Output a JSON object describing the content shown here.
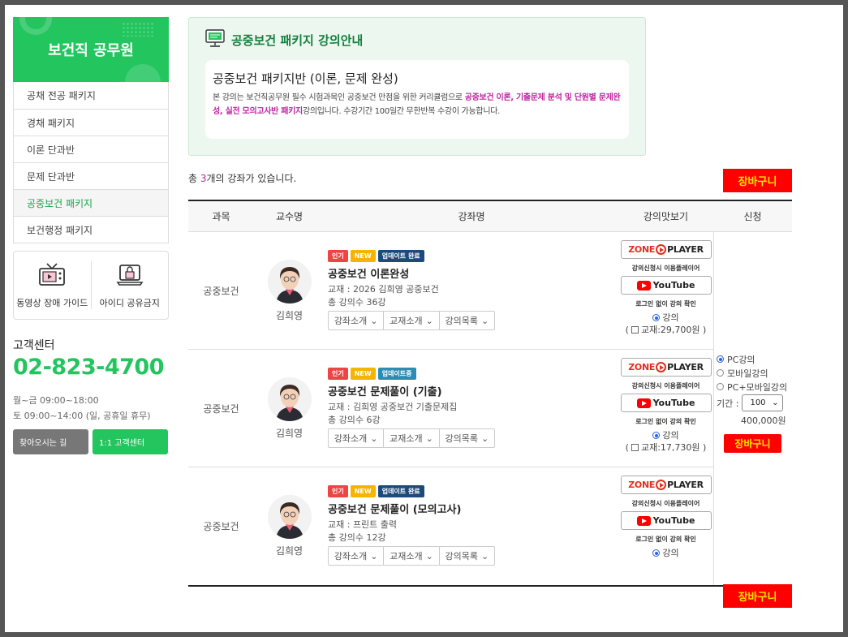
{
  "sidebar": {
    "title": "보건직 공무원",
    "items": [
      {
        "label": "공채 전공 패키지"
      },
      {
        "label": "경채 패키지"
      },
      {
        "label": "이론 단과반"
      },
      {
        "label": "문제 단과반"
      },
      {
        "label": "공중보건 패키지",
        "active": true
      },
      {
        "label": "보건행정 패키지"
      }
    ],
    "guides": [
      {
        "label": "동영상 장애 가이드",
        "icon": "tv-icon"
      },
      {
        "label": "아이디 공유금지",
        "icon": "laptop-lock-icon"
      }
    ],
    "cs": {
      "title": "고객센터",
      "phone": "02-823-4700",
      "hours1": "월~금 09:00~18:00",
      "hours2": "토 09:00~14:00 (일, 공휴일 휴무)",
      "btn_directions": "찾아오시는 길",
      "btn_support": "1:1 고객센터"
    }
  },
  "info": {
    "header": "공중보건 패키지 강의안내",
    "card_title": "공중보건 패키지반 (이론, 문제 완성)",
    "desc_pre": "본 강의는 보건직공무원 필수 시험과목인 공중보건 만점을 위한 커리큘럼으로 ",
    "desc_hl": "공중보건 이론, 기출문제 분석 및 단원별 문제완성, 실전 모의고사반 패키지",
    "desc_post": "강의입니다. 수강기간 100일간 무한반복 수강이 가능합니다."
  },
  "count": {
    "pre": "총 ",
    "num": "3",
    "post": "개의 강좌가 있습니다."
  },
  "cart_label": "장바구니",
  "table": {
    "headers": {
      "subject": "과목",
      "professor": "교수명",
      "course": "강좌명",
      "preview": "강의맛보기",
      "apply": "신청"
    },
    "rows": [
      {
        "subject": "공중보건",
        "professor": "김희영",
        "badges": [
          "인기",
          "NEW",
          "업데이트 완료"
        ],
        "title": "공중보건 이론완성",
        "book": "교재 : 2026 김희영 공중보건",
        "lectures": "총 강의수 36강",
        "book_price": "(",
        "book_price_label": "교재:29,700원 )"
      },
      {
        "subject": "공중보건",
        "professor": "김희영",
        "badges": [
          "인기",
          "NEW",
          "업데이트중"
        ],
        "title": "공중보건 문제풀이 (기출)",
        "book": "교재 : 김희영 공중보건 기출문제집",
        "lectures": "총 강의수 6강",
        "book_price": "(",
        "book_price_label": "교재:17,730원 )"
      },
      {
        "subject": "공중보건",
        "professor": "김희영",
        "badges": [
          "인기",
          "NEW",
          "업데이트 완료"
        ],
        "title": "공중보건 문제풀이 (모의고사)",
        "book": "교재 : 프린트 출력",
        "lectures": "총 강의수 12강"
      }
    ],
    "selects": [
      "강좌소개",
      "교재소개",
      "강의목록"
    ],
    "preview": {
      "zone_a": "ZONE",
      "zone_b": "PLAYER",
      "zone_note": "강의신청시 이용플레이어",
      "youtube": "YouTube",
      "yt_note": "로그인 없이 강의 확인",
      "radio_label": "강의"
    },
    "apply": {
      "options": [
        "PC강의",
        "모바일강의",
        "PC+모바일강의"
      ],
      "period_label": "기간 :",
      "period_value": "100",
      "price": "400,000원",
      "cart": "장바구니"
    }
  },
  "colors": {
    "brand_green": "#22c55e",
    "accent_magenta": "#c026a3",
    "cart_red": "#ff0000",
    "cart_text": "#ffe600"
  }
}
